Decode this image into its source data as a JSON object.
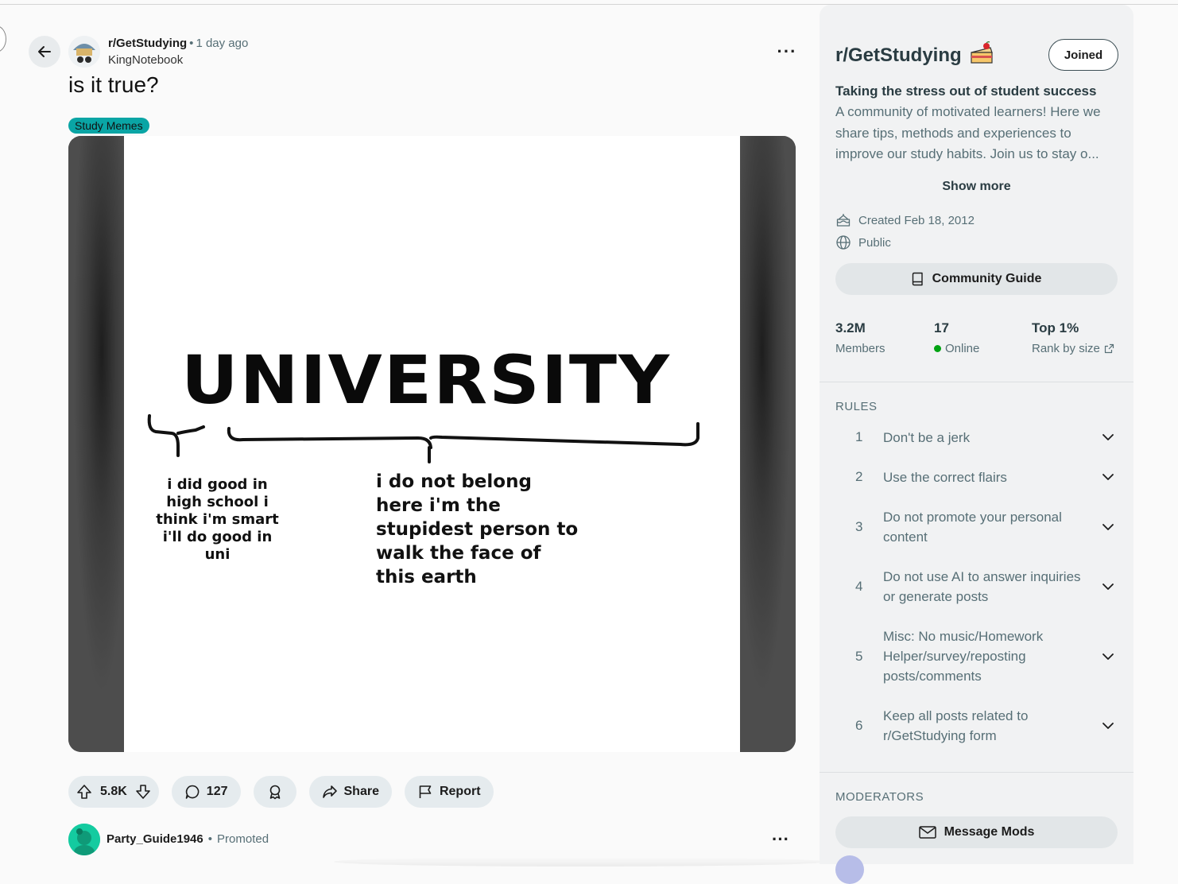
{
  "post": {
    "subreddit": "r/GetStudying",
    "separator": "•",
    "time": "1 day ago",
    "author": "KingNotebook",
    "title": "is it true?",
    "flair": "Study Memes",
    "flair_color": "#0aa5a5",
    "image": {
      "headline": "UNIVERSITY",
      "left_caption": "i did good in high school i think i'm smart i'll do good in uni",
      "right_caption": "i do not belong here i'm the stupidest person to walk the face of this earth"
    },
    "actions": {
      "upvotes": "5.8K",
      "comments": "127",
      "share_label": "Share",
      "report_label": "Report"
    }
  },
  "promoted": {
    "name": "Party_Guide1946",
    "separator": "•",
    "label": "Promoted"
  },
  "sidebar": {
    "title": "r/GetStudying",
    "joined_label": "Joined",
    "tagline": "Taking the stress out of student success",
    "description": "A community of motivated learners! Here we share tips, methods and experiences to improve our study habits. Join us to stay o...",
    "show_more": "Show more",
    "created": "Created Feb 18, 2012",
    "visibility": "Public",
    "guide_label": "Community Guide",
    "stats": {
      "members_value": "3.2M",
      "members_label": "Members",
      "online_value": "17",
      "online_label": "Online",
      "rank_value": "Top 1%",
      "rank_label": "Rank by size"
    },
    "rules_heading": "RULES",
    "rules": [
      {
        "num": "1",
        "text": "Don't be a jerk"
      },
      {
        "num": "2",
        "text": "Use the correct flairs"
      },
      {
        "num": "3",
        "text": "Do not promote your personal content"
      },
      {
        "num": "4",
        "text": "Do not use AI to answer inquiries or generate posts"
      },
      {
        "num": "5",
        "text": "Misc: No music/Homework Helper/survey/reposting posts/comments"
      },
      {
        "num": "6",
        "text": "Keep all posts related to r/GetStudying form"
      }
    ],
    "moderators_heading": "MODERATORS",
    "message_mods_label": "Message Mods"
  },
  "icons": [
    "back-arrow-icon",
    "more-icon",
    "upvote-icon",
    "downvote-icon",
    "comment-icon",
    "award-icon",
    "share-icon",
    "flag-icon",
    "cake-icon",
    "globe-icon",
    "book-icon",
    "external-link-icon",
    "chevron-down-icon",
    "mail-icon"
  ],
  "colors": {
    "accent_online": "#00a312",
    "pill_bg": "#e5ebee",
    "sidebar_bg": "#f1f2f3"
  }
}
